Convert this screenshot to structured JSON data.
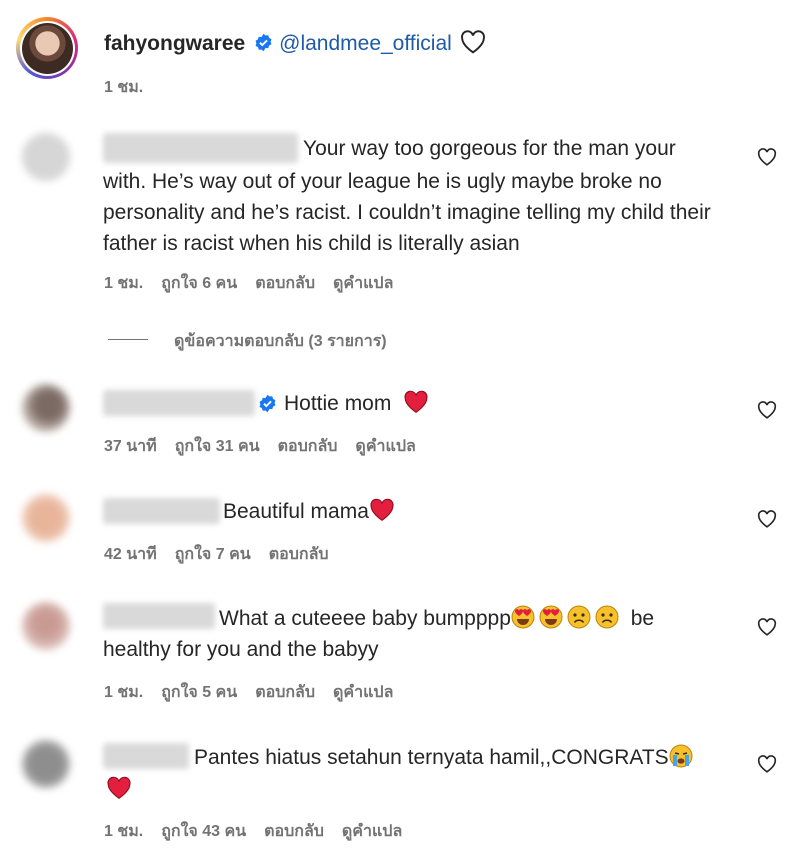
{
  "post": {
    "username": "fahyongwaree",
    "mention": "@landmee_official",
    "time": "1 ชม."
  },
  "comments": [
    {
      "text_line1": "Your way too gorgeous for the man your",
      "text_rest": "with. He’s way out of your league he is ugly maybe broke no personality and he’s racist. I couldn’t imagine telling my child their father is racist when his child is literally asian",
      "time": "1 ชม.",
      "likes": "ถูกใจ 6 คน",
      "reply": "ตอบกลับ",
      "translate": "ดูคำแปล"
    },
    {
      "text": "Hottie mom",
      "time": "37 นาที",
      "likes": "ถูกใจ 31 คน",
      "reply": "ตอบกลับ",
      "translate": "ดูคำแปล"
    },
    {
      "text": "Beautiful mama",
      "time": "42 นาที",
      "likes": "ถูกใจ 7 คน",
      "reply": "ตอบกลับ"
    },
    {
      "text_line1": "What a cuteeee baby bumpppp",
      "text_line1_end": "be",
      "text_line2": "healthy for you and the babyy",
      "time": "1 ชม.",
      "likes": "ถูกใจ 5 คน",
      "reply": "ตอบกลับ",
      "translate": "ดูคำแปล"
    },
    {
      "text": "Pantes hiatus setahun ternyata hamil,,CONGRATS",
      "time": "1 ชม.",
      "likes": "ถูกใจ 43 คน",
      "reply": "ตอบกลับ",
      "translate": "ดูคำแปล"
    }
  ],
  "view_replies": "ดูข้อความตอบกลับ (3 รายการ)",
  "icons": {
    "verified": "verified-badge-icon",
    "heart": "heart-outline-icon",
    "red_heart": "red-heart-emoji",
    "heart_eyes": "heart-eyes-emoji",
    "frown": "frown-emoji",
    "crying": "crying-emoji"
  },
  "colors": {
    "verified_blue": "#1877f2",
    "link_blue": "#1e5aa8",
    "meta_gray": "#737373",
    "heart_red": "#e41e3f"
  }
}
